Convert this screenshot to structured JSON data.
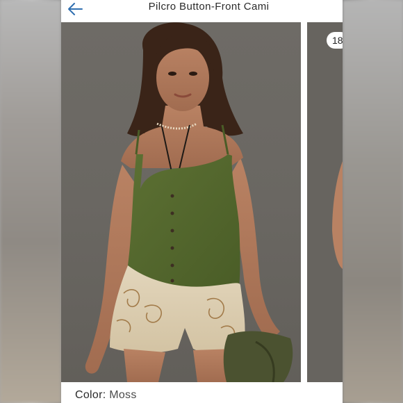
{
  "header": {
    "title": "Pilcro Button-Front Cami",
    "back_icon": "arrow-left-icon"
  },
  "gallery": {
    "counter": "18",
    "image_alt": "Model wearing olive green button-front ribbed cami with printed bubble shorts"
  },
  "product": {
    "color_label": "Color:",
    "color_value": "Moss"
  },
  "colors": {
    "accent": "#2f6fb0",
    "cami": "#556b2f",
    "background": "#6c6964"
  }
}
